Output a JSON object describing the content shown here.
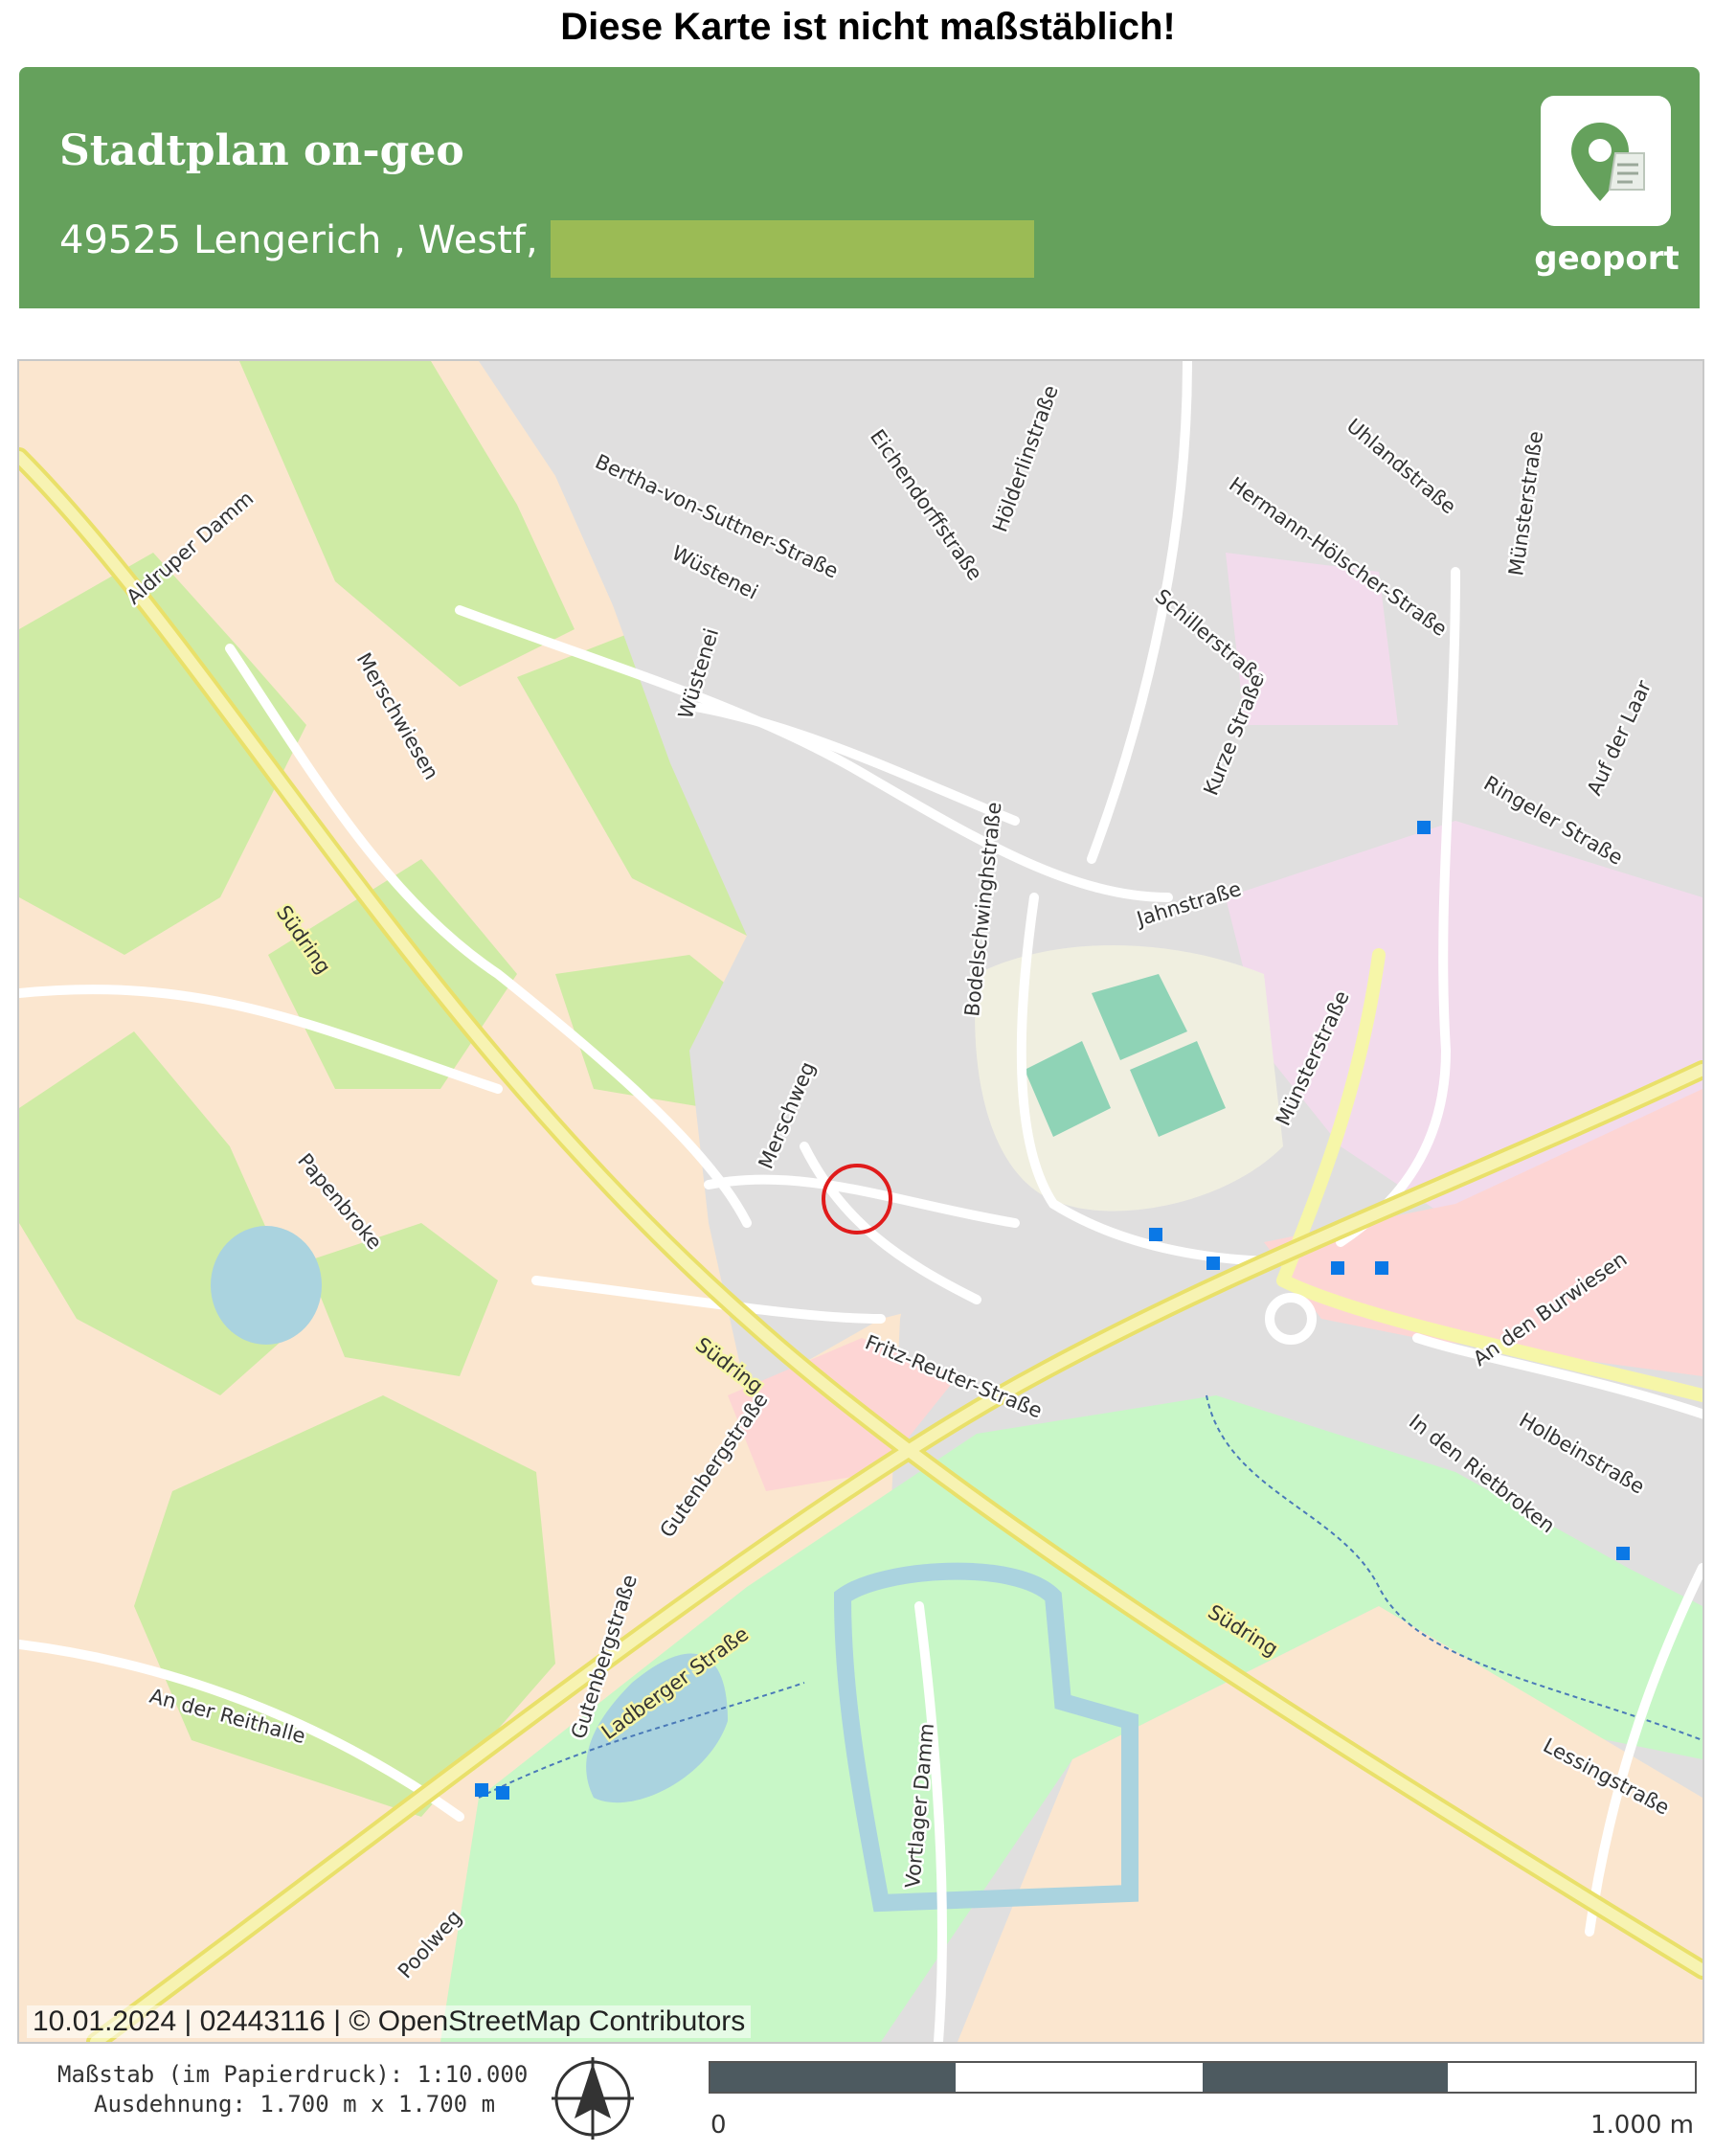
{
  "notice": "Diese Karte ist nicht maßstäblich!",
  "header": {
    "title": "Stadtplan on-geo",
    "address": "49525 Lengerich , Westf,",
    "logo_text": "geoport",
    "logo_icon": "map-pin-document-icon"
  },
  "map": {
    "credits": "10.01.2024 | 02443116 | © OpenStreetMap Contributors",
    "marker_icon": "red-circle-location-marker",
    "streets": {
      "aldruper_damm": "Aldruper Damm",
      "bertha": "Bertha-von-Suttner-Straße",
      "eichendorff": "Eichendorffstraße",
      "hoelderlin": "Hölderlinstraße",
      "uhland": "Uhlandstraße",
      "muenster_top": "Münsterstraße",
      "hermann": "Hermann-Hölscher-Straße",
      "wuestenei_1": "Wüstenei",
      "wuestenei_2": "Wüstenei",
      "schiller": "Schillerstraße",
      "kurze": "Kurze Straße",
      "auf_der_laar": "Auf der Laar",
      "merschwiesen": "Merschwiesen",
      "ringeler": "Ringeler Straße",
      "bodelschwingh": "Bodelschwinghstraße",
      "jahn": "Jahnstraße",
      "suedring_1": "Südring",
      "muenster_mid": "Münsterstraße",
      "merschweg": "Merschweg",
      "papenbroke": "Papenbroke",
      "fritz_reuter": "Fritz-Reuter-Straße",
      "an_den_burwiesen": "An den Burwiesen",
      "suedring_2": "Südring",
      "in_den_rietbroken": "In den Rietbroken",
      "holbein": "Holbeinstraße",
      "gutenberg_1": "Gutenbergstraße",
      "gutenberg_2": "Gutenbergstraße",
      "ladberger": "Ladberger Straße",
      "suedring_3": "Südring",
      "an_der_reithalle": "An der Reithalle",
      "vortlager_damm": "Vortlager Damm",
      "lessing": "Lessingstraße",
      "poolweg": "Poolweg"
    }
  },
  "footer": {
    "scale": "Maßstab (im Papierdruck): 1:10.000",
    "extent": "Ausdehnung: 1.700 m x 1.700 m",
    "north_icon": "north-arrow-icon",
    "scale_min": "0",
    "scale_max": "1.000 m"
  },
  "colors": {
    "header_green": "#65a15c",
    "redaction": "#9bbb55",
    "farmland": "#fbe6cf",
    "meadow": "#cfeba5",
    "park": "#c8f7c7",
    "residential": "#e0dfdf",
    "commercial": "#f2dbec",
    "retail": "#fdd5d4",
    "water": "#aad3df",
    "marker": "#e01b1b",
    "bus_stop": "#0a78e6"
  }
}
